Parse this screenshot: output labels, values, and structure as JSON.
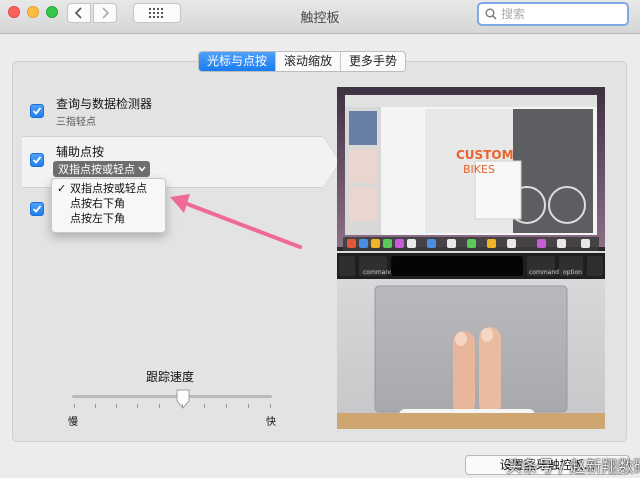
{
  "window": {
    "title": "触控板"
  },
  "search": {
    "placeholder": "搜索"
  },
  "tabs": [
    {
      "label": "光标与点按",
      "active": true
    },
    {
      "label": "滚动缩放",
      "active": false
    },
    {
      "label": "更多手势",
      "active": false
    }
  ],
  "options": {
    "lookup": {
      "title": "查询与数据检测器",
      "subtitle": "三指轻点",
      "checked": true
    },
    "secondary_click": {
      "title": "辅助点按",
      "checked": true,
      "selected": "双指点按或轻点"
    },
    "third": {
      "checked": true
    }
  },
  "secondary_menu": {
    "items": [
      {
        "label": "双指点按或轻点",
        "checked": true
      },
      {
        "label": "点按右下角",
        "checked": false
      },
      {
        "label": "点按左下角",
        "checked": false
      }
    ]
  },
  "tracking_speed": {
    "title": "跟踪速度",
    "min_label": "慢",
    "max_label": "快",
    "value": 0.52
  },
  "preview": {
    "poster_title": "CUSTOM BIKES",
    "touchbar": {
      "left_key": "command",
      "right_key": "command",
      "option_key": "option"
    }
  },
  "footer": {
    "setup_button": "设置蓝牙触控板...",
    "watermark": "头条号 / 赵新翔数码"
  },
  "colors": {
    "accent": "#1a7cf0",
    "arrow": "#f06a96"
  }
}
